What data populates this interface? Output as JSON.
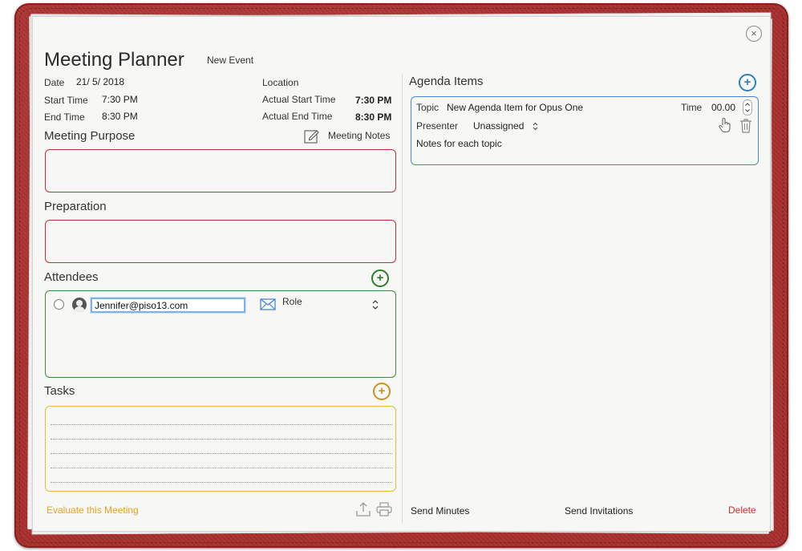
{
  "header": {
    "title": "Meeting Planner",
    "subtitle": "New Event",
    "close_symbol": "×"
  },
  "details": {
    "date_label": "Date",
    "date_value": "21/ 5/ 2018",
    "location_label": "Location",
    "start_label": "Start Time",
    "start_value": "7:30 PM",
    "actual_start_label": "Actual Start Time",
    "actual_start_value": "7:30 PM",
    "end_label": "End Time",
    "end_value": "8:30 PM",
    "actual_end_label": "Actual End Time",
    "actual_end_value": "8:30 PM"
  },
  "purpose": {
    "heading": "Meeting Purpose",
    "notes_label": "Meeting Notes"
  },
  "preparation": {
    "heading": "Preparation"
  },
  "attendees": {
    "heading": "Attendees",
    "add_symbol": "+",
    "row": {
      "email": "Jennifer@piso13.com",
      "role_label": "Role",
      "role_stepper": "⌃⌄"
    }
  },
  "tasks": {
    "heading": "Tasks",
    "add_symbol": "+"
  },
  "agenda": {
    "heading": "Agenda Items",
    "add_symbol": "+",
    "item": {
      "topic_label": "Topic",
      "topic_value": "New Agenda Item for Opus One",
      "time_label": "Time",
      "time_value": "00.00",
      "presenter_label": "Presenter",
      "presenter_value": "Unassigned",
      "notes": "Notes for each topic"
    }
  },
  "footer": {
    "evaluate": "Evaluate this Meeting",
    "send_minutes": "Send Minutes",
    "send_invitations": "Send Invitations",
    "delete": "Delete"
  },
  "colors": {
    "cover": "#a8302e",
    "purpose_border": "#b8323b",
    "attendees_border": "#3e8a3a",
    "tasks_border": "#e8b93a",
    "agenda_border": "#4a86d6",
    "evaluate_text": "#e6a21e",
    "delete_text": "#d0302a"
  }
}
